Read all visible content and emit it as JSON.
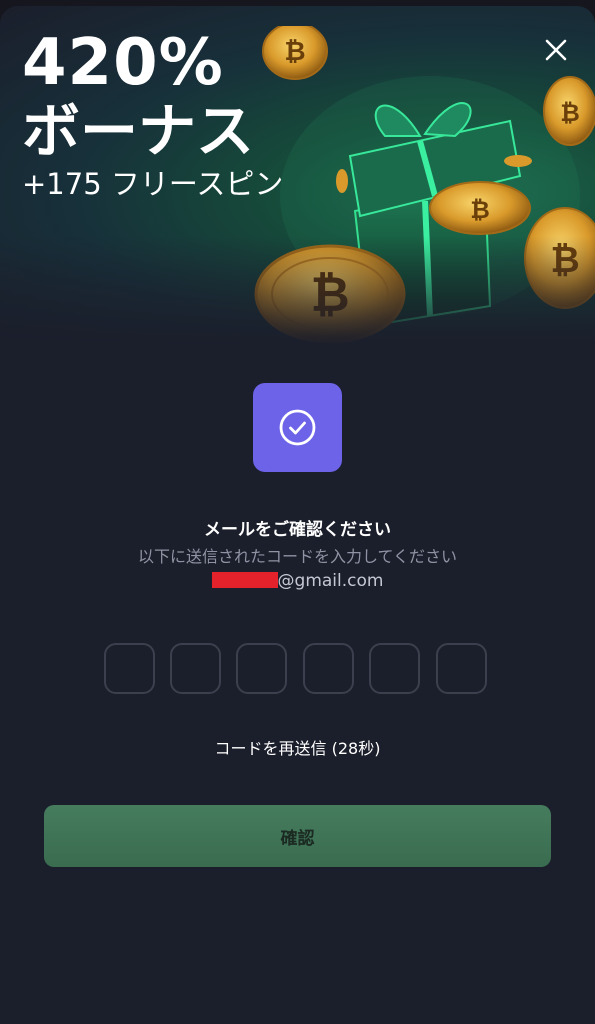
{
  "banner": {
    "headline_percent": "420%",
    "headline_word": "ボーナス",
    "subline": "+175 フリースピン"
  },
  "verify": {
    "title": "メールをご確認ください",
    "subtitle": "以下に送信されたコードを入力してください",
    "email_domain": "@gmail.com",
    "code_length": 6,
    "resend_label": "コードを再送信 (28秒)",
    "confirm_label": "確認"
  },
  "colors": {
    "accent_purple": "#6c63e8",
    "confirm_green": "#467c5e",
    "redaction_red": "#e3222c"
  },
  "icons": [
    "close-icon",
    "check-circle-icon",
    "gift-box-icon",
    "bitcoin-coin-icon"
  ]
}
